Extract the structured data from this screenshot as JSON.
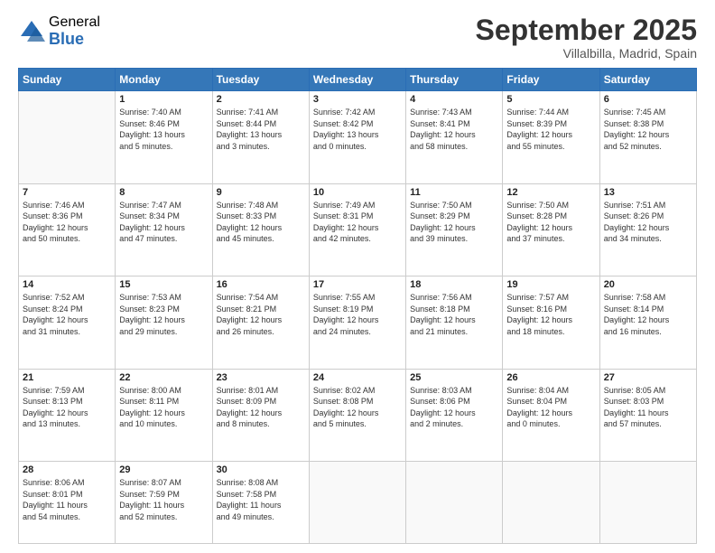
{
  "logo": {
    "general": "General",
    "blue": "Blue"
  },
  "header": {
    "month": "September 2025",
    "location": "Villalbilla, Madrid, Spain"
  },
  "weekdays": [
    "Sunday",
    "Monday",
    "Tuesday",
    "Wednesday",
    "Thursday",
    "Friday",
    "Saturday"
  ],
  "weeks": [
    [
      {
        "day": "",
        "info": ""
      },
      {
        "day": "1",
        "info": "Sunrise: 7:40 AM\nSunset: 8:46 PM\nDaylight: 13 hours\nand 5 minutes."
      },
      {
        "day": "2",
        "info": "Sunrise: 7:41 AM\nSunset: 8:44 PM\nDaylight: 13 hours\nand 3 minutes."
      },
      {
        "day": "3",
        "info": "Sunrise: 7:42 AM\nSunset: 8:42 PM\nDaylight: 13 hours\nand 0 minutes."
      },
      {
        "day": "4",
        "info": "Sunrise: 7:43 AM\nSunset: 8:41 PM\nDaylight: 12 hours\nand 58 minutes."
      },
      {
        "day": "5",
        "info": "Sunrise: 7:44 AM\nSunset: 8:39 PM\nDaylight: 12 hours\nand 55 minutes."
      },
      {
        "day": "6",
        "info": "Sunrise: 7:45 AM\nSunset: 8:38 PM\nDaylight: 12 hours\nand 52 minutes."
      }
    ],
    [
      {
        "day": "7",
        "info": "Sunrise: 7:46 AM\nSunset: 8:36 PM\nDaylight: 12 hours\nand 50 minutes."
      },
      {
        "day": "8",
        "info": "Sunrise: 7:47 AM\nSunset: 8:34 PM\nDaylight: 12 hours\nand 47 minutes."
      },
      {
        "day": "9",
        "info": "Sunrise: 7:48 AM\nSunset: 8:33 PM\nDaylight: 12 hours\nand 45 minutes."
      },
      {
        "day": "10",
        "info": "Sunrise: 7:49 AM\nSunset: 8:31 PM\nDaylight: 12 hours\nand 42 minutes."
      },
      {
        "day": "11",
        "info": "Sunrise: 7:50 AM\nSunset: 8:29 PM\nDaylight: 12 hours\nand 39 minutes."
      },
      {
        "day": "12",
        "info": "Sunrise: 7:50 AM\nSunset: 8:28 PM\nDaylight: 12 hours\nand 37 minutes."
      },
      {
        "day": "13",
        "info": "Sunrise: 7:51 AM\nSunset: 8:26 PM\nDaylight: 12 hours\nand 34 minutes."
      }
    ],
    [
      {
        "day": "14",
        "info": "Sunrise: 7:52 AM\nSunset: 8:24 PM\nDaylight: 12 hours\nand 31 minutes."
      },
      {
        "day": "15",
        "info": "Sunrise: 7:53 AM\nSunset: 8:23 PM\nDaylight: 12 hours\nand 29 minutes."
      },
      {
        "day": "16",
        "info": "Sunrise: 7:54 AM\nSunset: 8:21 PM\nDaylight: 12 hours\nand 26 minutes."
      },
      {
        "day": "17",
        "info": "Sunrise: 7:55 AM\nSunset: 8:19 PM\nDaylight: 12 hours\nand 24 minutes."
      },
      {
        "day": "18",
        "info": "Sunrise: 7:56 AM\nSunset: 8:18 PM\nDaylight: 12 hours\nand 21 minutes."
      },
      {
        "day": "19",
        "info": "Sunrise: 7:57 AM\nSunset: 8:16 PM\nDaylight: 12 hours\nand 18 minutes."
      },
      {
        "day": "20",
        "info": "Sunrise: 7:58 AM\nSunset: 8:14 PM\nDaylight: 12 hours\nand 16 minutes."
      }
    ],
    [
      {
        "day": "21",
        "info": "Sunrise: 7:59 AM\nSunset: 8:13 PM\nDaylight: 12 hours\nand 13 minutes."
      },
      {
        "day": "22",
        "info": "Sunrise: 8:00 AM\nSunset: 8:11 PM\nDaylight: 12 hours\nand 10 minutes."
      },
      {
        "day": "23",
        "info": "Sunrise: 8:01 AM\nSunset: 8:09 PM\nDaylight: 12 hours\nand 8 minutes."
      },
      {
        "day": "24",
        "info": "Sunrise: 8:02 AM\nSunset: 8:08 PM\nDaylight: 12 hours\nand 5 minutes."
      },
      {
        "day": "25",
        "info": "Sunrise: 8:03 AM\nSunset: 8:06 PM\nDaylight: 12 hours\nand 2 minutes."
      },
      {
        "day": "26",
        "info": "Sunrise: 8:04 AM\nSunset: 8:04 PM\nDaylight: 12 hours\nand 0 minutes."
      },
      {
        "day": "27",
        "info": "Sunrise: 8:05 AM\nSunset: 8:03 PM\nDaylight: 11 hours\nand 57 minutes."
      }
    ],
    [
      {
        "day": "28",
        "info": "Sunrise: 8:06 AM\nSunset: 8:01 PM\nDaylight: 11 hours\nand 54 minutes."
      },
      {
        "day": "29",
        "info": "Sunrise: 8:07 AM\nSunset: 7:59 PM\nDaylight: 11 hours\nand 52 minutes."
      },
      {
        "day": "30",
        "info": "Sunrise: 8:08 AM\nSunset: 7:58 PM\nDaylight: 11 hours\nand 49 minutes."
      },
      {
        "day": "",
        "info": ""
      },
      {
        "day": "",
        "info": ""
      },
      {
        "day": "",
        "info": ""
      },
      {
        "day": "",
        "info": ""
      }
    ]
  ]
}
